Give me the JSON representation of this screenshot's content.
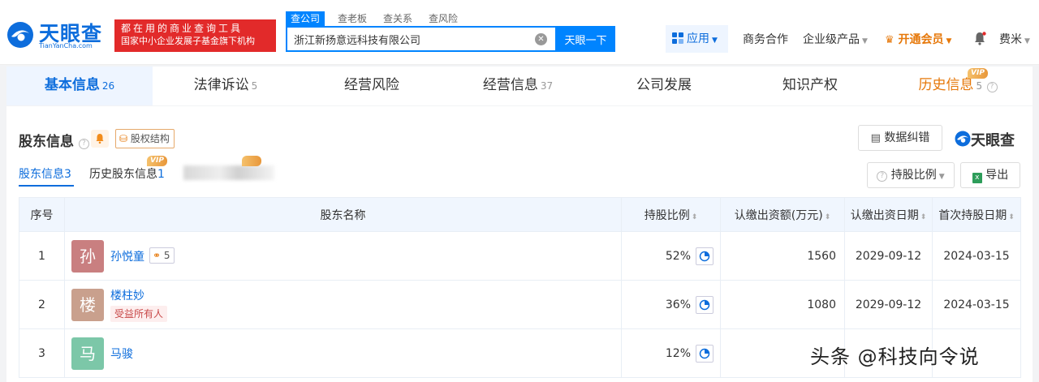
{
  "header": {
    "logo": {
      "name": "天眼查",
      "domain": "TianYanCha.com"
    },
    "ad": {
      "line1": "都在用的商业查询工具",
      "line2": "国家中小企业发展子基金旗下机构"
    },
    "search_tabs": [
      "查公司",
      "查老板",
      "查关系",
      "查风险"
    ],
    "search_value": "浙江新扬意远科技有限公司",
    "search_button": "天眼一下",
    "app_button": "应用",
    "nav": {
      "business": "商务合作",
      "enterprise": "企业级产品",
      "vip": "开通会员",
      "user": "费米"
    }
  },
  "main_tabs": [
    {
      "label": "基本信息",
      "count": "26"
    },
    {
      "label": "法律诉讼",
      "count": "5"
    },
    {
      "label": "经营风险",
      "count": ""
    },
    {
      "label": "经营信息",
      "count": "37"
    },
    {
      "label": "公司发展",
      "count": ""
    },
    {
      "label": "知识产权",
      "count": ""
    },
    {
      "label": "历史信息",
      "count": "5",
      "badge": "VIP"
    }
  ],
  "section": {
    "title": "股东信息",
    "equity_structure": "股权结构",
    "data_correction": "数据纠错",
    "brand": "天眼查",
    "sub_tabs": [
      {
        "label": "股东信息",
        "count": "3"
      },
      {
        "label": "历史股东信息",
        "count": "1",
        "badge": "VIP"
      }
    ],
    "sort_button": "持股比例",
    "export_button": "导出",
    "table": {
      "headers": [
        "序号",
        "股东名称",
        "持股比例",
        "认缴出资额(万元)",
        "认缴出资日期",
        "首次持股日期"
      ],
      "rows": [
        {
          "idx": "1",
          "avatar": "孙",
          "name": "孙悦童",
          "equity_count": "5",
          "tag": "",
          "ratio": "52%",
          "amount": "1560",
          "date": "2029-09-12",
          "first_date": "2024-03-15"
        },
        {
          "idx": "2",
          "avatar": "楼",
          "name": "楼柱妙",
          "equity_count": "",
          "tag": "受益所有人",
          "ratio": "36%",
          "amount": "1080",
          "date": "2029-09-12",
          "first_date": "2024-03-15"
        },
        {
          "idx": "3",
          "avatar": "马",
          "name": "马骏",
          "equity_count": "",
          "tag": "",
          "ratio": "12%",
          "amount": "",
          "date": "",
          "first_date": ""
        }
      ]
    }
  },
  "watermark": "头条 @科技向令说",
  "colors": {
    "brand_blue": "#0d6ddc",
    "search_blue": "#0084ff",
    "vip_orange": "#e6780a",
    "ad_red": "#e22a2a",
    "avatar_sun": "#c97f80",
    "avatar_lou": "#c9a08d",
    "avatar_ma": "#7cc7a8"
  }
}
